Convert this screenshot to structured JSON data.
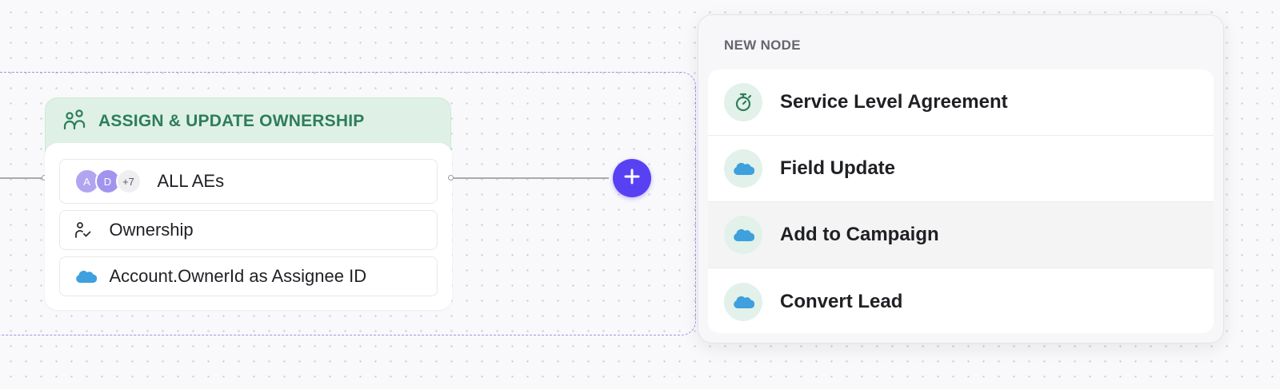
{
  "node": {
    "title": "ASSIGN & UPDATE OWNERSHIP",
    "icon": "users-icon",
    "assignees": {
      "avatars": [
        "A",
        "D"
      ],
      "more": "+7",
      "label": "ALL AEs"
    },
    "action": {
      "icon": "user-check-icon",
      "label": "Ownership"
    },
    "source": {
      "icon": "salesforce-cloud-icon",
      "label": "Account.OwnerId as Assignee ID"
    }
  },
  "add_button": {
    "icon": "plus-icon"
  },
  "panel": {
    "title": "NEW NODE",
    "items": [
      {
        "label": "Service Level Agreement",
        "icon": "stopwatch-icon"
      },
      {
        "label": "Field Update",
        "icon": "salesforce-cloud-icon"
      },
      {
        "label": "Add to Campaign",
        "icon": "salesforce-cloud-icon"
      },
      {
        "label": "Convert Lead",
        "icon": "salesforce-cloud-icon"
      }
    ]
  },
  "colors": {
    "accent": "#5841f2",
    "node_header_bg": "#dff1e6",
    "node_header_text": "#2e7d5b",
    "salesforce_blue": "#3ea0dd",
    "group_outline": "#9b95f0"
  }
}
